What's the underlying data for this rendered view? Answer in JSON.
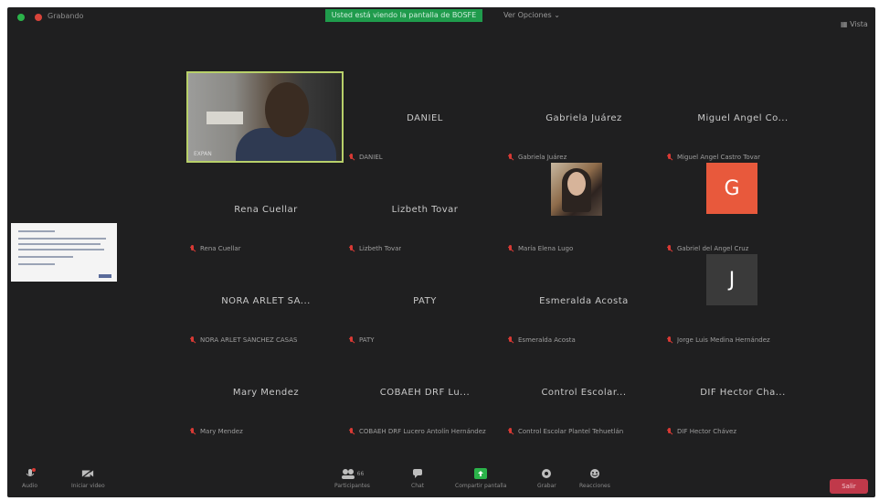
{
  "topbar": {
    "rec_label": "Grabando",
    "share_banner": "Usted está viendo la pantalla de BOSFE",
    "view_menu": "Ver Opciones ⌄",
    "view_toggle": "▦ Vista"
  },
  "tiles": [
    {
      "name": "",
      "label": "Gabriel",
      "type": "video",
      "caption": "EXPAN"
    },
    {
      "name": "DANIEL",
      "label": "DANIEL",
      "type": "name"
    },
    {
      "name": "Gabriela Juárez",
      "label": "Gabriela Juárez",
      "type": "name"
    },
    {
      "name": "Miguel Angel Co...",
      "label": "Miguel Angel Castro Tovar",
      "type": "name"
    },
    {
      "name": "Rena Cuellar",
      "label": "Rena Cuellar",
      "type": "name"
    },
    {
      "name": "Lizbeth Tovar",
      "label": "Lizbeth Tovar",
      "type": "name"
    },
    {
      "name": "",
      "label": "María Elena Lugo",
      "type": "photo"
    },
    {
      "name": "",
      "label": "Gabriel del Angel Cruz",
      "type": "avatar",
      "avatar_letter": "G",
      "avatar_color": "#e8593c",
      "avatar_text_color": "#ffffff"
    },
    {
      "name": "NORA ARLET SA...",
      "label": "NORA ARLET SÁNCHEZ CASAS",
      "type": "name"
    },
    {
      "name": "PATY",
      "label": "PATY",
      "type": "name"
    },
    {
      "name": "Esmeralda Acosta",
      "label": "Esmeralda Acosta",
      "type": "name"
    },
    {
      "name": "",
      "label": "Jorge Luis Medina Hernández",
      "type": "avatar",
      "avatar_letter": "J",
      "avatar_color": "#3a3a3a",
      "avatar_text_color": "#ffffff"
    },
    {
      "name": "Mary Mendez",
      "label": "Mary Mendez",
      "type": "name"
    },
    {
      "name": "COBAEH DRF Lu...",
      "label": "COBAEH DRF Lucero Antolín Hernández",
      "type": "name"
    },
    {
      "name": "Control Escolar...",
      "label": "Control Escolar Plantel Tehuetlán",
      "type": "name"
    },
    {
      "name": "DIF Hector Cha...",
      "label": "DIF Hector Chávez",
      "type": "name"
    }
  ],
  "toolbar": {
    "audio": "Audio",
    "video": "Iniciar video",
    "participants": "Participantes",
    "participants_count": "66",
    "chat": "Chat",
    "share": "Compartir pantalla",
    "record": "Grabar",
    "reactions": "Reacciones",
    "end": "Salir"
  },
  "colors": {
    "share_banner": "#1f9b4c",
    "active_speaker_border": "#b8d06a",
    "muted": "#d83a34",
    "end_button": "#c0394a"
  }
}
